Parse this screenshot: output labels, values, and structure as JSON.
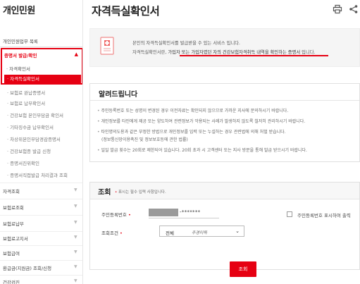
{
  "sidebar": {
    "title": "개인민원",
    "home_link": "개인민원업무 목록",
    "group": {
      "label": "증명서 발급/확인",
      "items": [
        "자격확인서",
        "자격득실확인서"
      ]
    },
    "subitems": [
      "보험료 완납증명서",
      "보험료 납부확인서",
      "건강보험 본인부담금 확인서",
      "기타징수금 납부확인서",
      "차상위본인부담경감증명서",
      "건강보험증 발급 신청",
      "증명서진위확인",
      "증명서직접발급 처리결과 조회"
    ],
    "categories": [
      "자격조회",
      "보험료조회",
      "보험료납부",
      "보험료고지서",
      "보험급여",
      "환급금(지원금) 조회/신청",
      "건강검진"
    ]
  },
  "page": {
    "title": "자격득실확인서",
    "icons": {
      "print": "print-icon",
      "share": "share-icon"
    }
  },
  "intro": {
    "line1": "본인의 자격득실확인서를 발급받을 수 있는 서비스 입니다.",
    "line2_a": "자격득실확인서란, ",
    "line2_b": "가입자 또는 가입자였던 자의 건강보험자격취득 내역을 확인하는 증명서",
    "line2_c": " 입니다."
  },
  "notice": {
    "title": "알려드립니다",
    "items": [
      "주민등록번호 또는 성명이 변경된 경우 이전자료는 확인되지 않으므로 가까운 지사에 문의하시기 바랍니다.",
      "개인정보를 타인에게 제공 또는 양도하여 관련정보가 악용되는 사례가 발생하지 않도록 철저히 관리하시기 바랍니다.",
      "타인명의도용과 같은 부정한 방법으로 개인정보를 입력 또는 누설하는 경우 관련법에 의해 처벌 받습니다.",
      "(정보통신망이용촉진 및 정보보호등에 관한 법률)",
      "일일 발급 횟수는 20회로 제한되어 있습니다. 20회 초과 시 고객센터 또는 지사 방문을 통해 발급 받으시기 바랍니다."
    ]
  },
  "search": {
    "title": "조회",
    "required_note": "표시는 필수 입력 사항입니다.",
    "rrn_label": "주민등록번호",
    "rrn_rest": "-*******",
    "show_rrn_label": "주민등록번호 표시하여 출력",
    "condition_label": "조회조건",
    "condition_value": "전체",
    "condition_hint": "추경이득",
    "submit_label": "조회"
  },
  "colors": {
    "accent": "#e60012"
  }
}
